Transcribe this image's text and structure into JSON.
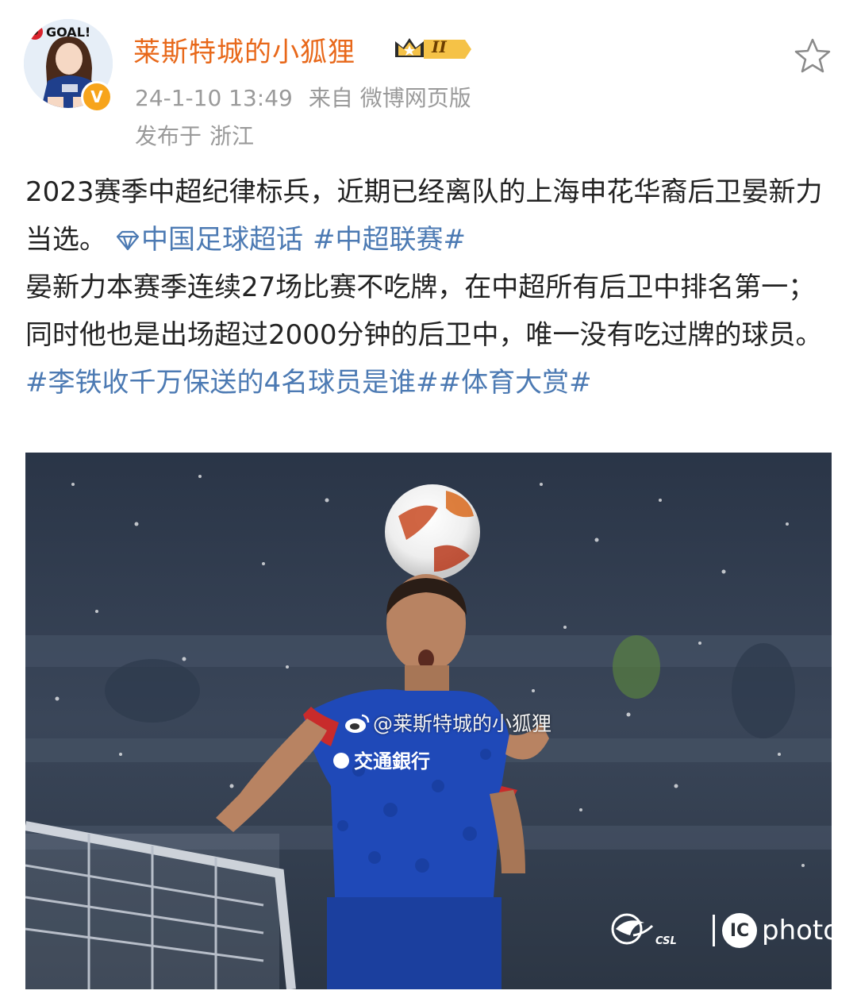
{
  "author": {
    "name": "莱斯特城的小狐狸",
    "avatar_icon": "avatar-goal-girl",
    "avatar_text": "GOAL!",
    "verified_icon": "verified-v-icon",
    "verified_mark": "V",
    "level_badge": "II",
    "name_color": "#e8681a"
  },
  "meta": {
    "time": "24-1-10 13:49",
    "source_prefix": "来自",
    "source": "微博网页版",
    "location_prefix": "发布于",
    "location": "浙江"
  },
  "post": {
    "line1": "2023赛季中超纪律标兵，近期已经离队的上海申花华裔后卫晏新力当选。",
    "supertopic": "中国足球超话",
    "topic1": "#中超联赛#",
    "para2": "晏新力本赛季连续27场比赛不吃牌，在中超所有后卫中排名第一；同时他也是出场超过2000分钟的后卫中，唯一没有吃过牌的球员。",
    "topic2": "#李铁收千万保送的4名球员是谁#",
    "topic3": "#体育大赏#",
    "topic_color": "#4c7ab3"
  },
  "photo": {
    "watermark": "@莱斯特城的小狐狸",
    "sponsor_text": "交通銀行",
    "csl_label": "CSL",
    "ic_label": "IC",
    "photo_word": "photo"
  }
}
